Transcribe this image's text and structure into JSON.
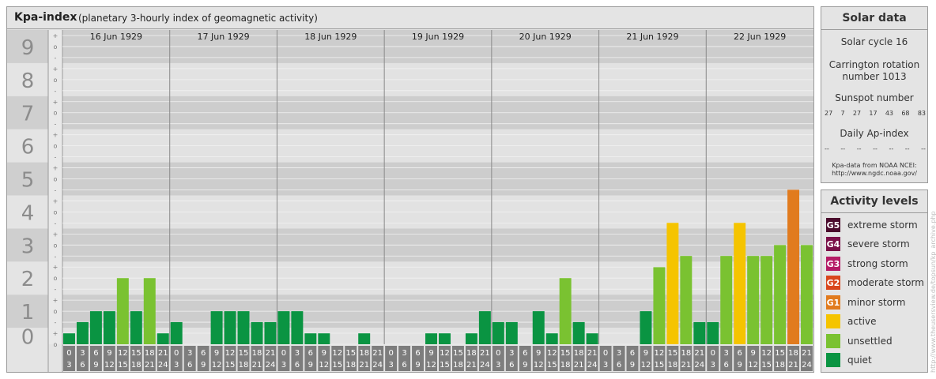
{
  "header": {
    "title": "Kpa-index",
    "subtitle": "(planetary 3-hourly index of geomagnetic activity)"
  },
  "colors": {
    "quiet": "#0a9442",
    "unsettled": "#7ac231",
    "active": "#f5c400",
    "G1": "#e17b1e",
    "G2": "#d9461d",
    "G3": "#b51b66",
    "G4": "#7a1048",
    "G5": "#4a0b2c"
  },
  "chart_data": {
    "type": "bar",
    "title": "Kpa-index",
    "ylim": [
      0,
      9
    ],
    "y_ticks": [
      "0",
      "1",
      "2",
      "3",
      "4",
      "5",
      "6",
      "7",
      "8",
      "9"
    ],
    "y_subticks": [
      "-",
      "o",
      "+"
    ],
    "days": [
      "16 Jun 1929",
      "17 Jun 1929",
      "18 Jun 1929",
      "19 Jun 1929",
      "20 Jun 1929",
      "21 Jun 1929",
      "22 Jun 1929"
    ],
    "interval_start_labels": [
      "0",
      "3",
      "6",
      "9",
      "12",
      "15",
      "18",
      "21"
    ],
    "interval_end_labels": [
      "3",
      "6",
      "9",
      "12",
      "15",
      "18",
      "21",
      "24"
    ],
    "values": [
      [
        0.33,
        0.67,
        1.0,
        1.0,
        2.0,
        1.0,
        2.0,
        0.33
      ],
      [
        0.67,
        0.0,
        0.0,
        1.0,
        1.0,
        1.0,
        0.67,
        0.67
      ],
      [
        1.0,
        1.0,
        0.33,
        0.33,
        0.0,
        0.0,
        0.33,
        0.0
      ],
      [
        0.0,
        0.0,
        0.0,
        0.33,
        0.33,
        0.0,
        0.33,
        1.0
      ],
      [
        0.67,
        0.67,
        0.0,
        1.0,
        0.33,
        2.0,
        0.67,
        0.33
      ],
      [
        0.0,
        0.0,
        0.0,
        1.0,
        2.33,
        3.67,
        2.67,
        0.67
      ],
      [
        0.67,
        2.67,
        3.67,
        2.67,
        2.67,
        3.0,
        4.67,
        3.0
      ]
    ]
  },
  "solar": {
    "title": "Solar data",
    "cycle": "Solar cycle 16",
    "carrington_line1": "Carrington rotation",
    "carrington_line2": "number 1013",
    "sunspot_title": "Sunspot number",
    "sunspots": [
      "27",
      "7",
      "27",
      "17",
      "43",
      "68",
      "83"
    ],
    "ap_title": "Daily Ap-index",
    "ap_values": [
      "--",
      "--",
      "--",
      "--",
      "--",
      "--",
      "--"
    ],
    "credit_line1": "Kpa-data from NOAA NCEI:",
    "credit_line2": "http://www.ngdc.noaa.gov/"
  },
  "activity": {
    "title": "Activity levels",
    "levels": [
      {
        "badge": "G5",
        "label": "extreme storm",
        "color": "#4a0b2c"
      },
      {
        "badge": "G4",
        "label": "severe storm",
        "color": "#7a1048"
      },
      {
        "badge": "G3",
        "label": "strong storm",
        "color": "#b51b66"
      },
      {
        "badge": "G2",
        "label": "moderate storm",
        "color": "#d9461d"
      },
      {
        "badge": "G1",
        "label": "minor storm",
        "color": "#e17b1e"
      },
      {
        "badge": "",
        "label": "active",
        "color": "#f5c400"
      },
      {
        "badge": "",
        "label": "unsettled",
        "color": "#7ac231"
      },
      {
        "badge": "",
        "label": "quiet",
        "color": "#0a9442"
      }
    ]
  },
  "watermark": "http://www.theusersview.de/topsun/kp_archive.php"
}
